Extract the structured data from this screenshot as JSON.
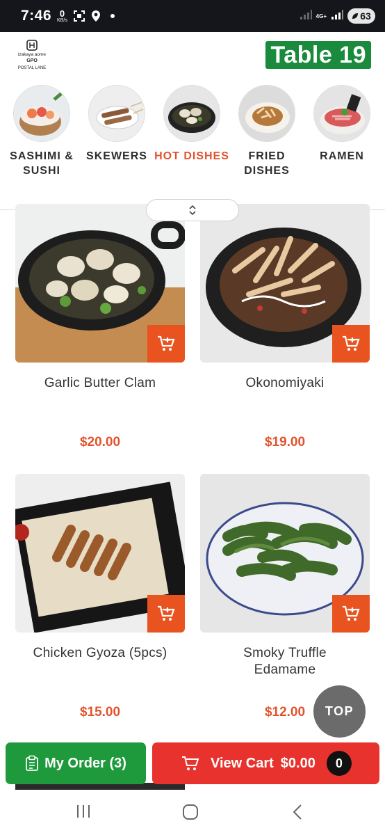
{
  "status_bar": {
    "time": "7:46",
    "speed_value": "0",
    "speed_unit": "KB/s",
    "network": "4G+",
    "battery": "63"
  },
  "header": {
    "logo_text": "izakaya aome · GPO · POSTAL LANE",
    "table_label": "Table 19"
  },
  "categories": [
    {
      "label": "SASHIMI & SUSHI",
      "active": false
    },
    {
      "label": "SKEWERS",
      "active": false
    },
    {
      "label": "HOT DISHES",
      "active": true
    },
    {
      "label": "FRIED DISHES",
      "active": false
    },
    {
      "label": "RAMEN",
      "active": false
    }
  ],
  "menu_items": [
    {
      "name": "Garlic Butter Clam",
      "price": "$20.00"
    },
    {
      "name": "Okonomiyaki",
      "price": "$19.00"
    },
    {
      "name": "Chicken Gyoza (5pcs)",
      "price": "$15.00"
    },
    {
      "name": "Smoky Truffle Edamame",
      "price": "$12.00"
    }
  ],
  "top_button": "TOP",
  "order_button": {
    "label": "My Order (3)"
  },
  "cart_button": {
    "label": "View Cart",
    "total": "$0.00",
    "count": "0"
  },
  "colors": {
    "accent": "#e2532c",
    "green": "#1a8a3c",
    "cart_red": "#e8322d",
    "add_orange": "#e9531f"
  }
}
